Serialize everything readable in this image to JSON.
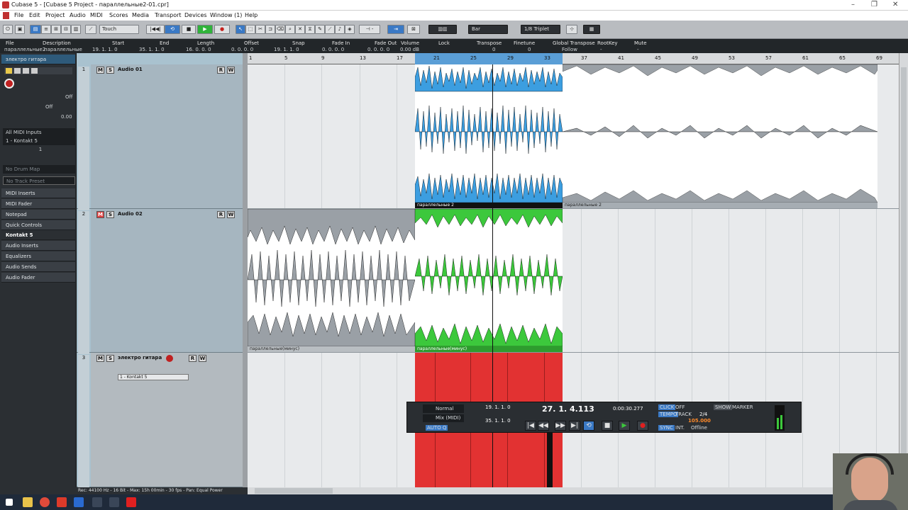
{
  "titlebar": {
    "title": "Cubase 5 - [Cubase 5 Project - параллельные2-01.cpr]",
    "minimize": "–",
    "maximize": "❐",
    "close": "✕"
  },
  "menu": [
    "File",
    "Edit",
    "Project",
    "Audio",
    "MIDI",
    "Scores",
    "Media",
    "Transport",
    "Devices",
    "Window (1)",
    "Help"
  ],
  "toolbar": {
    "automation_mode": "Touch",
    "grid_type": "Bar",
    "quantize": "1/8 Triplet"
  },
  "infoline": {
    "headers": [
      "File",
      "Description",
      "Start",
      "End",
      "Length",
      "Offset",
      "Snap",
      "Fade In",
      "Fade Out",
      "Volume",
      "Lock",
      "Transpose",
      "Finetune",
      "Global Transpose",
      "RootKey",
      "Mute"
    ],
    "values": [
      "параллельные2",
      "параллельные",
      "19. 1. 1. 0",
      "35. 1. 1. 0",
      "16. 0. 0. 0",
      "0. 0. 0. 0",
      "19. 1. 1. 0",
      "0. 0. 0. 0",
      "0. 0. 0. 0",
      "0.00 dB",
      "",
      "0",
      "0",
      "Follow",
      "-",
      "-"
    ]
  },
  "inspector": {
    "track_name": "электро гитара",
    "off_label": "Off",
    "value_off": "Off",
    "value_zero": "0.00",
    "midi_input": "All MIDI Inputs",
    "midi_output": "1 - Kontakt 5",
    "channel": "1",
    "drum_map": "No Drum Map",
    "track_preset": "No Track Preset",
    "sections": [
      "MIDI Inserts",
      "MIDI Fader",
      "Notepad",
      "Quick Controls"
    ],
    "instrument": "Kontakt 5",
    "inst_sections": [
      "Audio Inserts",
      "Equalizers",
      "Audio Sends",
      "Audio Fader"
    ]
  },
  "tracks": [
    {
      "num": "1",
      "name": "Audio 01",
      "m": "M",
      "s": "S",
      "r": "R",
      "w": "W"
    },
    {
      "num": "2",
      "name": "Audio 02",
      "m": "M",
      "s": "S",
      "r": "R",
      "w": "W"
    },
    {
      "num": "3",
      "name": "электро гитара",
      "m": "M",
      "s": "S",
      "r": "R",
      "w": "W",
      "output": "1 - Kontakt 5"
    }
  ],
  "ruler": [
    "1",
    "5",
    "9",
    "13",
    "17",
    "21",
    "25",
    "29",
    "33",
    "37",
    "41",
    "45",
    "49",
    "53",
    "57",
    "61",
    "65",
    "69"
  ],
  "events": {
    "audio1_selected_label": "параллельные 2",
    "audio1_rest_label": "параллельные 2",
    "audio2_gray_label": "параллельные(минус)",
    "audio2_green_label": "параллельные(минус)"
  },
  "transport": {
    "mode": "Normal",
    "mix": "Mix (MIDI)",
    "auto_q": "AUTO Q",
    "left_locator": "19. 1. 1. 0",
    "right_locator": "35. 1. 1. 0",
    "position_bars": "27. 1. 4.113",
    "position_time": "0:00:30.277",
    "click": "CLICK",
    "click_state": "OFF",
    "tempo": "TEMPO",
    "track_label": "TRACK",
    "time_sig": "2/4",
    "tempo_value": "105.000",
    "sync": "SYNC",
    "int": "INT.",
    "offline": "Offline",
    "show": "SHOW",
    "marker": "MARKER"
  },
  "status": "Rec: 44100 Hz - 16 Bit - Max: 15h 00min - 30 fps - Pan: Equal Power",
  "colors": {
    "audio_blue": "#3c9ee0",
    "audio_green": "#3cc83c",
    "midi_red": "#e23232",
    "wave_gray": "#9aa0a6"
  }
}
